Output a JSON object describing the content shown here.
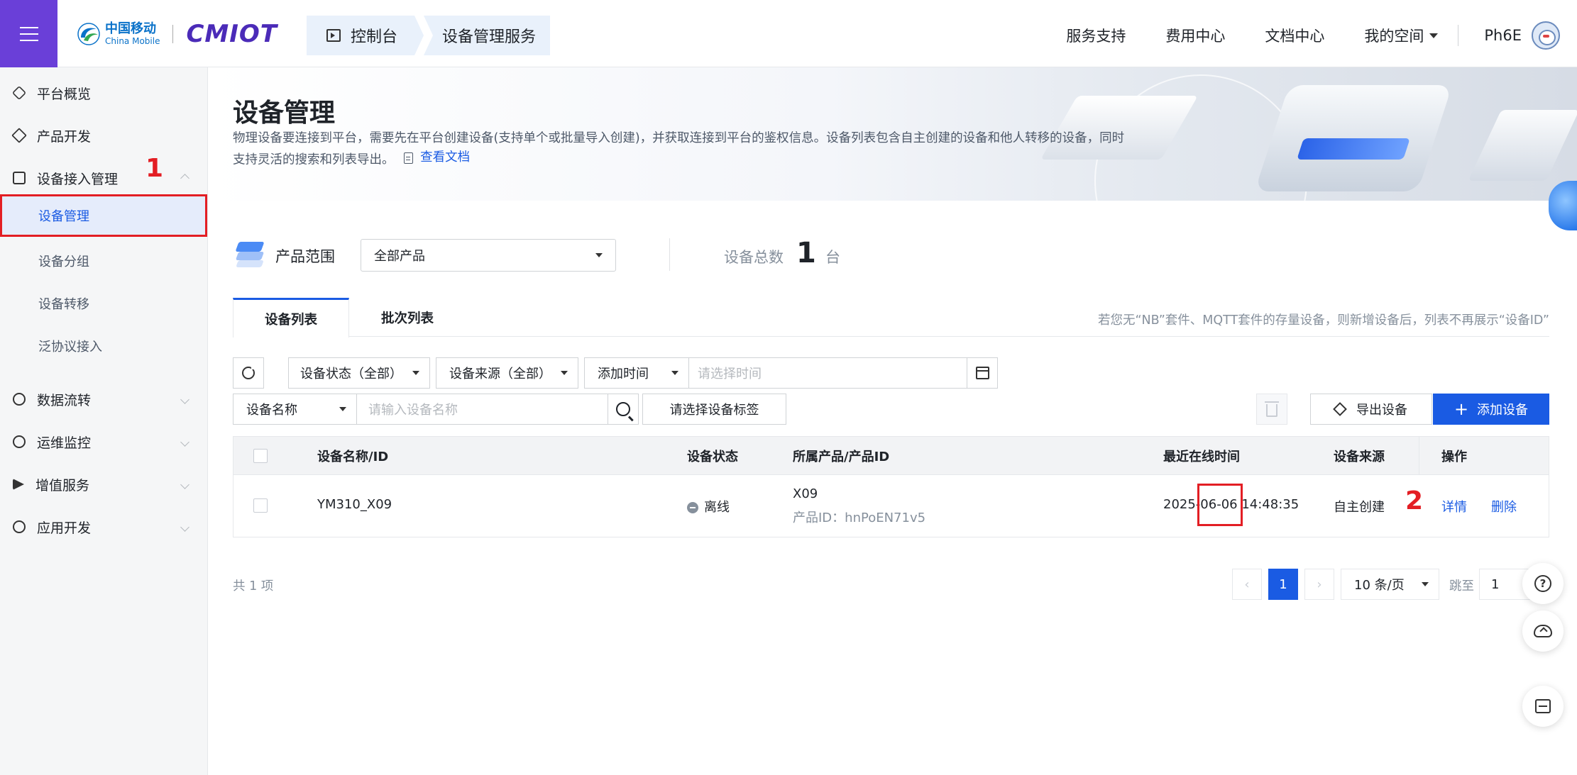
{
  "header": {
    "brand_cn": "中国移动",
    "brand_en": "China Mobile",
    "brand_product": "cmiot",
    "breadcrumb": [
      "控制台",
      "设备管理服务"
    ],
    "nav": [
      "服务支持",
      "费用中心",
      "文档中心",
      "我的空间"
    ],
    "username": "Ph6E"
  },
  "sidebar": {
    "items": [
      {
        "label": "平台概览",
        "icon": "hexagon-icon"
      },
      {
        "label": "产品开发",
        "icon": "cube-icon"
      },
      {
        "label": "设备接入管理",
        "icon": "device-access-icon",
        "expanded": true,
        "children": [
          "设备管理",
          "设备分组",
          "设备转移",
          "泛协议接入"
        ],
        "active_child": "设备管理"
      },
      {
        "label": "数据流转",
        "icon": "data-flow-icon"
      },
      {
        "label": "运维监控",
        "icon": "monitor-icon"
      },
      {
        "label": "增值服务",
        "icon": "send-icon"
      },
      {
        "label": "应用开发",
        "icon": "app-dev-icon"
      }
    ]
  },
  "annotations": {
    "step1": "1",
    "step2": "2"
  },
  "page": {
    "title": "设备管理",
    "description_line1": "物理设备要连接到平台，需要先在平台创建设备(支持单个或批量导入创建)，并获取连接到平台的鉴权信息。设备列表包含自主创建的设备和他人转移的设备，同时",
    "description_line2": "支持灵活的搜索和列表导出。",
    "doc_link": "查看文档"
  },
  "product_range": {
    "label": "产品范围",
    "selected": "全部产品",
    "total_label": "设备总数",
    "total_value": "1",
    "total_unit": "台"
  },
  "tabs": {
    "items": [
      "设备列表",
      "批次列表"
    ],
    "active": "设备列表",
    "hint": "若您无“NB”套件、MQTT套件的存量设备，则新增设备后，列表不再展示“设备ID”"
  },
  "filters": {
    "status": "设备状态（全部）",
    "source": "设备来源（全部）",
    "time_field": "添加时间",
    "time_placeholder": "请选择时间",
    "name_field": "设备名称",
    "name_placeholder": "请输入设备名称",
    "tag_placeholder": "请选择设备标签",
    "export_label": "导出设备",
    "add_label": "添加设备"
  },
  "table": {
    "columns": [
      "设备名称/ID",
      "设备状态",
      "所属产品/产品ID",
      "最近在线时间",
      "设备来源",
      "操作"
    ],
    "rows": [
      {
        "name": "YM310_X09",
        "status": "离线",
        "product": "X09",
        "product_id": "产品ID：hnPoEN71v5",
        "last_online": "2025-06-06 14:48:35",
        "source": "自主创建",
        "actions": [
          "详情",
          "删除"
        ]
      }
    ]
  },
  "pagination": {
    "total": "共 1 项",
    "current": "1",
    "prev": "‹",
    "next": "›",
    "page_size": "10 条/页",
    "jump_label": "跳至",
    "jump_value": "1"
  },
  "colors": {
    "accent": "#1a5be3",
    "menu": "#6a3fd8",
    "highlight": "#e31e24"
  }
}
